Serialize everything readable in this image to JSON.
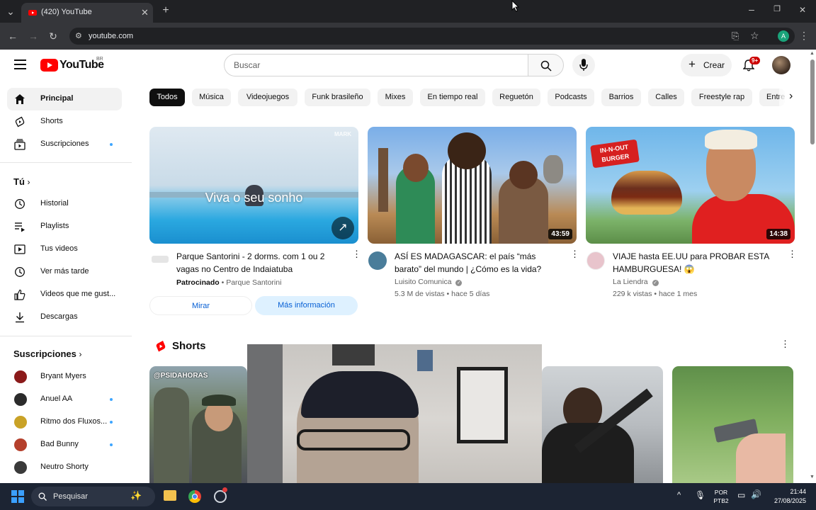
{
  "browser": {
    "tab_title": "(420) YouTube",
    "url": "youtube.com",
    "profile_initial": "A"
  },
  "header": {
    "logo_text": "YouTube",
    "region": "BR",
    "search_placeholder": "Buscar",
    "create_label": "Crear",
    "notif_badge": "9+"
  },
  "sidebar": {
    "main": [
      {
        "label": "Principal",
        "icon": "home-icon"
      },
      {
        "label": "Shorts",
        "icon": "shorts-icon"
      },
      {
        "label": "Suscripciones",
        "icon": "subscriptions-icon"
      }
    ],
    "you_heading": "Tú",
    "you": [
      {
        "label": "Historial",
        "icon": "history-icon"
      },
      {
        "label": "Playlists",
        "icon": "playlist-icon"
      },
      {
        "label": "Tus videos",
        "icon": "your-videos-icon"
      },
      {
        "label": "Ver más tarde",
        "icon": "watch-later-icon"
      },
      {
        "label": "Videos que me gust...",
        "icon": "like-icon"
      },
      {
        "label": "Descargas",
        "icon": "download-icon"
      }
    ],
    "subs_heading": "Suscripciones",
    "subs": [
      {
        "label": "Bryant Myers",
        "color": "#8b1a1a"
      },
      {
        "label": "Anuel AA",
        "color": "#2b2b2b"
      },
      {
        "label": "Ritmo dos Fluxos...",
        "color": "#c9a227"
      },
      {
        "label": "Bad Bunny",
        "color": "#b5402c"
      },
      {
        "label": "Neutro Shorty",
        "color": "#3a3a3a"
      }
    ]
  },
  "chips": [
    "Todos",
    "Música",
    "Videojuegos",
    "Funk brasileño",
    "Mixes",
    "En tiempo real",
    "Reguetón",
    "Podcasts",
    "Barrios",
    "Calles",
    "Freestyle rap",
    "Entre"
  ],
  "videos": [
    {
      "title": "Parque Santorini - 2 dorms. com 1 ou 2 vagas no Centro de Indaiatuba",
      "thumb_text": "Viva o seu sonho",
      "watermark": "MARK",
      "sponsored": "Patrocinado",
      "advertiser": "Parque Santorini",
      "btn_watch": "Mirar",
      "btn_more": "Más información"
    },
    {
      "title": "ASÍ ES MADAGASCAR: el país “más barato” del mundo | ¿Cómo es la vida?",
      "channel": "Luisito Comunica",
      "stats": "5.3 M de vistas • hace 5 días",
      "duration": "43:59"
    },
    {
      "title": "VIAJE hasta EE.UU para PROBAR ESTA HAMBURGUESA! 😱",
      "channel": "La Liendra",
      "stats": "229 k vistas • hace 1 mes",
      "duration": "14:38",
      "thumb_text": "IN-N-OUT BURGER"
    }
  ],
  "shorts": {
    "heading": "Shorts",
    "first_overlay": "@PSIDAHORAS"
  },
  "taskbar": {
    "search_placeholder": "Pesquisar",
    "lang_line1": "POR",
    "lang_line2": "PTB2",
    "time": "21:44",
    "date": "27/08/2025"
  },
  "colors": {
    "youtube_red": "#ff0000",
    "chrome_dark": "#202124",
    "taskbar": "#1c2433"
  }
}
